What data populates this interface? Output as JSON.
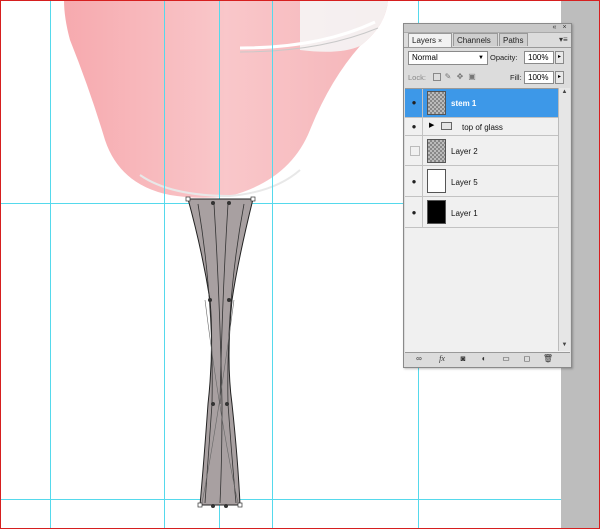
{
  "colors": {
    "accent_selected": "#3d98e8",
    "guide": "#55d9ec",
    "frame": "#d61f1f",
    "stem_fill": "#a8a0a1",
    "glass_fill": "#f7b6b9"
  },
  "panel": {
    "tabs": [
      {
        "label": "Layers",
        "close": "×",
        "active": true
      },
      {
        "label": "Channels",
        "active": false
      },
      {
        "label": "Paths",
        "active": false
      }
    ],
    "menu_icon": "▾≡",
    "collapse_icon": "«",
    "close_icon": "×",
    "blend_mode": "Normal",
    "opacity_label": "Opacity:",
    "opacity_value": "100%",
    "lock_label": "Lock:",
    "fill_label": "Fill:",
    "fill_value": "100%",
    "lock_icons": [
      "lock-transparency-icon",
      "lock-paint-icon",
      "lock-move-icon",
      "lock-all-icon"
    ],
    "layers": [
      {
        "name": "stem 1",
        "visible": true,
        "selected": true,
        "thumb": "checker"
      },
      {
        "name": "top of glass",
        "visible": true,
        "selected": false,
        "thumb": "folder",
        "group": true
      },
      {
        "name": "Layer 2",
        "visible": false,
        "selected": false,
        "thumb": "checker"
      },
      {
        "name": "Layer 5",
        "visible": true,
        "selected": false,
        "thumb": "white"
      },
      {
        "name": "Layer 1",
        "visible": true,
        "selected": false,
        "thumb": "black"
      }
    ],
    "bottom_icons": [
      "link-icon",
      "fx-icon",
      "mask-icon",
      "adjustment-icon",
      "group-icon",
      "new-layer-icon",
      "trash-icon"
    ]
  }
}
